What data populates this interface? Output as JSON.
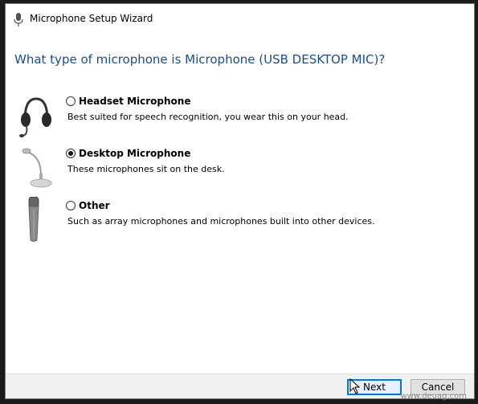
{
  "window": {
    "title": "Microphone Setup Wizard"
  },
  "heading": "What type of microphone is Microphone (USB DESKTOP MIC)?",
  "options": [
    {
      "label": "Headset Microphone",
      "description": "Best suited for speech recognition, you wear this on your head.",
      "selected": false,
      "icon": "headset-icon"
    },
    {
      "label": "Desktop Microphone",
      "description": "These microphones sit on the desk.",
      "selected": true,
      "icon": "desktop-mic-icon"
    },
    {
      "label": "Other",
      "description": "Such as array microphones and microphones built into other devices.",
      "selected": false,
      "icon": "handheld-mic-icon"
    }
  ],
  "buttons": {
    "next": "Next",
    "cancel": "Cancel"
  },
  "watermark": "www.deuag.com",
  "colors": {
    "heading": "#1a4e8c",
    "default_button_border": "#0078d7"
  }
}
